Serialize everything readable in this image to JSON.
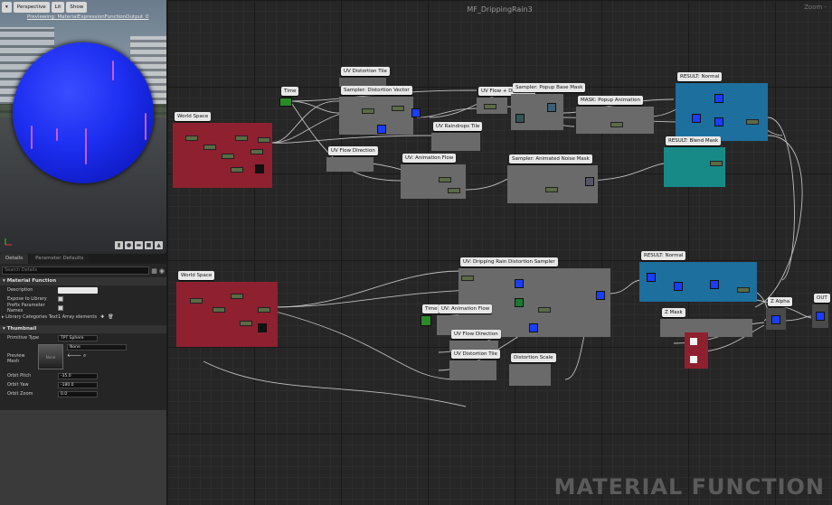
{
  "viewport": {
    "toolbar": [
      "▾",
      "Perspective",
      "Lit",
      "Show"
    ],
    "preview_label": "Previewing: MaterialExpressionFunctionOutput_0"
  },
  "details": {
    "tabs": [
      "Details",
      "Parameter Defaults"
    ],
    "search_placeholder": "Search Details",
    "section_function": "Material Function",
    "rows": [
      {
        "label": "Description"
      },
      {
        "label": "Expose to Library"
      },
      {
        "label": "Prefix Parameter Names"
      },
      {
        "label": "Library Categories Text",
        "value": "1 Array elements"
      }
    ],
    "section_thumbnail": "Thumbnail",
    "primitive_type": {
      "label": "Primitive Type",
      "value": "TPT Sphere"
    },
    "preview_mesh": {
      "label": "Preview Mesh",
      "thumb": "None",
      "value": "None"
    },
    "orbit": [
      {
        "label": "Orbit Pitch",
        "value": "-35.0"
      },
      {
        "label": "Orbit Yaw",
        "value": "-180.0"
      },
      {
        "label": "Orbit Zoom",
        "value": "0.0"
      }
    ]
  },
  "graph": {
    "title": "MF_DrippingRain3",
    "zoom": "Zoom -",
    "watermark": "MATERIAL FUNCTION",
    "comments": [
      {
        "key": "world1",
        "label": "World Space"
      },
      {
        "key": "time1",
        "label": "Time"
      },
      {
        "key": "uvdist",
        "label": "UV Distortion Tile"
      },
      {
        "key": "sampdist",
        "label": "Sampler: Distortion Vector"
      },
      {
        "key": "raintile",
        "label": "UV Raindrops Tile"
      },
      {
        "key": "uvflowdist",
        "label": "UV Flow + Distortion"
      },
      {
        "key": "popup",
        "label": "Sampler: Popup Base Mask"
      },
      {
        "key": "maskpopup",
        "label": "MASK: Popup Animation"
      },
      {
        "key": "uvflowdir",
        "label": "UV Flow Direction"
      },
      {
        "key": "uvanim",
        "label": "UV: Animation Flow"
      },
      {
        "key": "animnoise",
        "label": "Sampler: Animated Noise Mask"
      },
      {
        "key": "resnormal",
        "label": "RESULT: Normal"
      },
      {
        "key": "resblend",
        "label": "RESULT: Blend Mask"
      },
      {
        "key": "world2",
        "label": "World Space"
      },
      {
        "key": "drip",
        "label": "UV: Dripping Rain Distortion Sampler"
      },
      {
        "key": "resnormal2",
        "label": "RESULT: Normal"
      },
      {
        "key": "time2",
        "label": "Time"
      },
      {
        "key": "uvanim2",
        "label": "UV: Animation Flow"
      },
      {
        "key": "uvflowdir2",
        "label": "UV Flow Direction"
      },
      {
        "key": "uvdist2",
        "label": "UV Distortion Tile"
      },
      {
        "key": "distscale",
        "label": "Distortion Scale"
      },
      {
        "key": "zmask",
        "label": "Z Mask"
      },
      {
        "key": "zalpha",
        "label": "Z Alpha"
      },
      {
        "key": "out",
        "label": "OUT"
      }
    ]
  },
  "colors": {
    "world": "#8e2030",
    "result_blue": "#1d6f9e",
    "result_teal": "#178a88",
    "gray": "#5c5c5c",
    "wire": "#d9d9d9"
  }
}
